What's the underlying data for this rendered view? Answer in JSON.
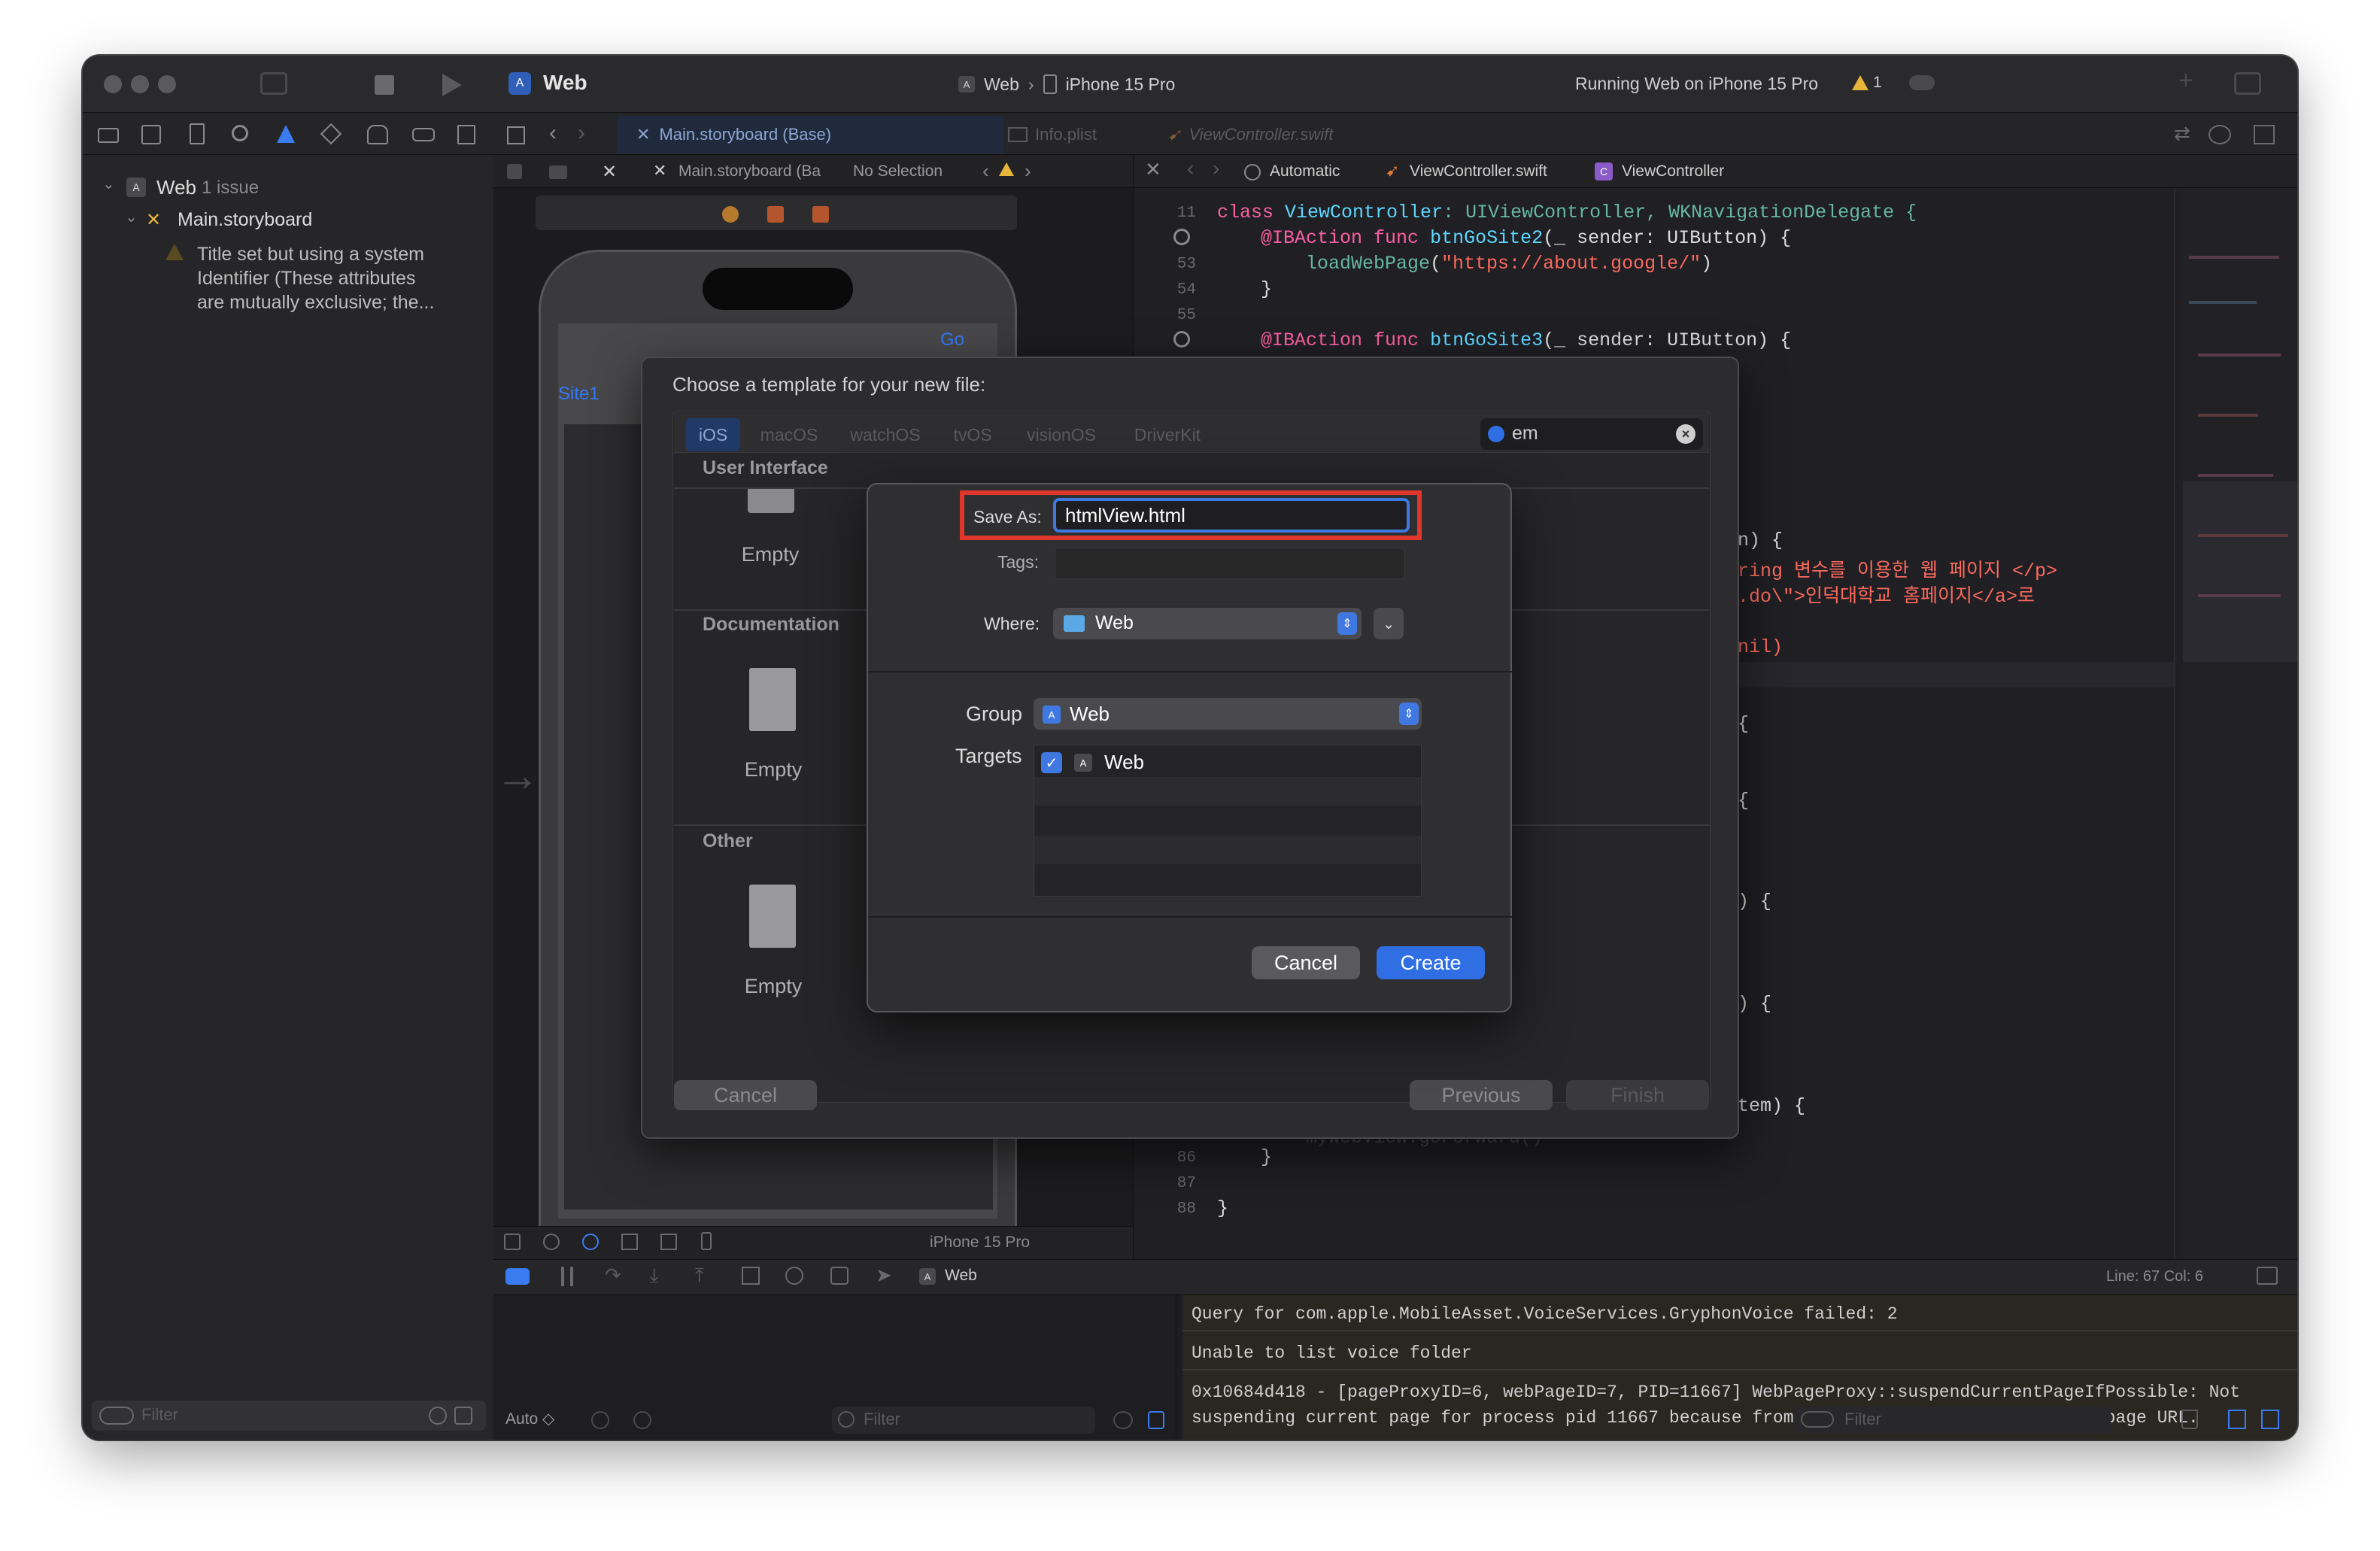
{
  "window": {
    "project_name": "Web",
    "scheme_target": "Web",
    "scheme_device": "iPhone 15 Pro",
    "status_text": "Running Web on iPhone 15 Pro",
    "warning_count": "1"
  },
  "editor_tabs": [
    {
      "label": "Main.storyboard (Base)"
    },
    {
      "label": "Info.plist"
    },
    {
      "label": "ViewController.swift"
    }
  ],
  "navigator": {
    "project_label": "Web",
    "issue_count": "1 issue",
    "file_label": "Main.storyboard",
    "issue_text_1": "Title set but using a system",
    "issue_text_2": "Identifier (These attributes",
    "issue_text_3": "are mutually exclusive; the...",
    "filter_placeholder": "Filter"
  },
  "ib_jumpbar": {
    "file": "Main.storyboard (Ba",
    "selection": "No Selection"
  },
  "canvas": {
    "go_button": "Go",
    "site1_button": "Site1",
    "device_label": "iPhone 15 Pro"
  },
  "code_jumpbar": {
    "mode": "Automatic",
    "file": "ViewController.swift",
    "symbol": "ViewController"
  },
  "code": {
    "line_numbers": [
      "11",
      "53",
      "54",
      "55",
      "",
      "",
      "",
      "",
      "",
      "",
      "",
      "",
      "",
      "",
      "",
      "",
      "",
      "",
      "",
      "",
      "",
      "",
      "",
      "",
      "",
      "",
      "86",
      "87",
      "88"
    ],
    "visible": {
      "l11_kw": "class",
      "l11_ty": "ViewController",
      "l11_rest": ": UIViewController, WKNavigationDelegate {",
      "l52_attr": "@IBAction",
      "l52_kw": "func",
      "l52_fn": "btnGoSite2",
      "l52_rest": "(_ sender: UIButton) {",
      "l53_fn": "loadWebPage",
      "l53_str": "\"https://about.google/\"",
      "l53_close": ")",
      "l54": "}",
      "l56_attr": "@IBAction",
      "l56_kw": "func",
      "l56_fn": "btnGoSite3",
      "l56_rest": "(_ sender: UIButton) {",
      "frag_1": "n) {",
      "frag_2": "ring 변수를 이용한 웹 페이지 </p>",
      "frag_3": ".do\\\">인덕대학교 홈페이지</a>로",
      "frag_4": "nil)",
      "frag_5": "{",
      "frag_6": "{",
      "frag_7": ") {",
      "frag_8": ") {",
      "frag_9": "tem) {",
      "frag_10": "myWebView.goForward()",
      "l86": "}",
      "l88": "}"
    }
  },
  "status_bar": {
    "line_col": "Line: 67  Col: 6",
    "debug_target": "Web",
    "auto_label": "Auto ◇",
    "filter_placeholder": "Filter",
    "filter2_placeholder": "Filter"
  },
  "console": {
    "lines": [
      "Query for com.apple.MobileAsset.VoiceServices.GryphonVoice failed: 2",
      "Unable to list voice folder",
      "0x10684d418 - [pageProxyID=6, webPageID=7, PID=11667] WebPageProxy::suspendCurrentPageIfPossible: Not",
      "suspending current page for process pid 11667 because fromItem's URL does not match the page URL."
    ]
  },
  "template_sheet": {
    "title": "Choose a template for your new file:",
    "platform_tabs": [
      "iOS",
      "macOS",
      "watchOS",
      "tvOS",
      "visionOS",
      "DriverKit"
    ],
    "search_value": "em",
    "sections": [
      "User Interface",
      "Documentation",
      "Other"
    ],
    "template_labels": [
      "Empty",
      "Empty",
      "Empty"
    ],
    "cancel": "Cancel",
    "previous": "Previous",
    "finish": "Finish"
  },
  "save_dialog": {
    "save_as_label": "Save As:",
    "save_as_value": "htmlView.html",
    "tags_label": "Tags:",
    "where_label": "Where:",
    "where_value": "Web",
    "group_label": "Group",
    "group_value": "Web",
    "targets_label": "Targets",
    "target_name": "Web",
    "target_checked": true,
    "cancel": "Cancel",
    "create": "Create"
  },
  "colors": {
    "accent": "#2f6fe3",
    "highlight_box": "#e0372d",
    "keyword": "#fc5fa3",
    "type": "#5dd8ff",
    "string": "#fc6a5d",
    "warning": "#e6b53a"
  }
}
